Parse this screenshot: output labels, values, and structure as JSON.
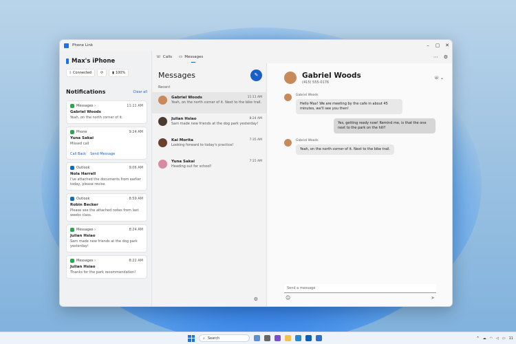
{
  "app": {
    "title": "Phone Link"
  },
  "device": {
    "name": "Max's iPhone",
    "status": "Connected",
    "battery": "100%"
  },
  "tabs": [
    {
      "label": "Calls"
    },
    {
      "label": "Messages"
    }
  ],
  "notifications": {
    "title": "Notifications",
    "clear_all": "Clear all",
    "items": [
      {
        "app": "Messages ›",
        "time": "11:11 AM",
        "sender": "Gabriel Woods",
        "text": "Yeah, on the north corner of it.",
        "color": "#2ea44f"
      },
      {
        "app": "Phone",
        "time": "9:24 AM",
        "sender": "Yuna Sakai",
        "text": "Missed call",
        "color": "#2ea44f",
        "actions": [
          "Call Back",
          "Send Message"
        ]
      },
      {
        "app": "Outlook",
        "time": "9:06 AM",
        "sender": "Nola Harrell",
        "text": "I've attached the documents from earlier today, please revise.",
        "color": "#0f6cbd"
      },
      {
        "app": "Outlook",
        "time": "8:59 AM",
        "sender": "Robin Becker",
        "text": "Please see the attached notes from last weeks class.",
        "color": "#0f6cbd"
      },
      {
        "app": "Messages ›",
        "time": "8:24 AM",
        "sender": "Julian Hsiao",
        "text": "Sam made new friends at the dog park yesterday!",
        "color": "#2ea44f"
      },
      {
        "app": "Messages ›",
        "time": "8:22 AM",
        "sender": "Julian Hsiao",
        "text": "Thanks for the park recommendation!",
        "color": "#2ea44f"
      }
    ]
  },
  "messages": {
    "title": "Messages",
    "recent": "Recent",
    "conversations": [
      {
        "name": "Gabriel Woods",
        "time": "11:11 AM",
        "text": "Yeah, on the north corner of it. Next to the bike trail.",
        "avatar_color": "#c98a5a"
      },
      {
        "name": "Julian Hsiao",
        "time": "8:24 AM",
        "text": "Sam made new friends at the dog park yesterday!",
        "avatar_color": "#4b3a2e"
      },
      {
        "name": "Kai Morita",
        "time": "7:35 AM",
        "text": "Looking forward to today's practice!",
        "avatar_color": "#6b3e2e"
      },
      {
        "name": "Yuna Sakai",
        "time": "7:15 AM",
        "text": "Heading out for school!",
        "avatar_color": "#d78aa0"
      }
    ]
  },
  "chat": {
    "name": "Gabriel Woods",
    "phone": "(415) 555-0176",
    "thread": [
      {
        "dir": "in",
        "sender": "Gabriel Woods",
        "text": "Hello Max! We are meeting by the cafe in about 45 minutes, we'll see you then!"
      },
      {
        "dir": "out",
        "text": "Yes, getting ready now! Remind me, is that the one next to the park on the hill?"
      },
      {
        "dir": "in",
        "sender": "Gabriel Woods",
        "text": "Yeah, on the north corner of it. Next to the bike trail."
      }
    ],
    "input_placeholder": "Send a message"
  },
  "taskbar": {
    "search": "Search",
    "clock": "11"
  }
}
